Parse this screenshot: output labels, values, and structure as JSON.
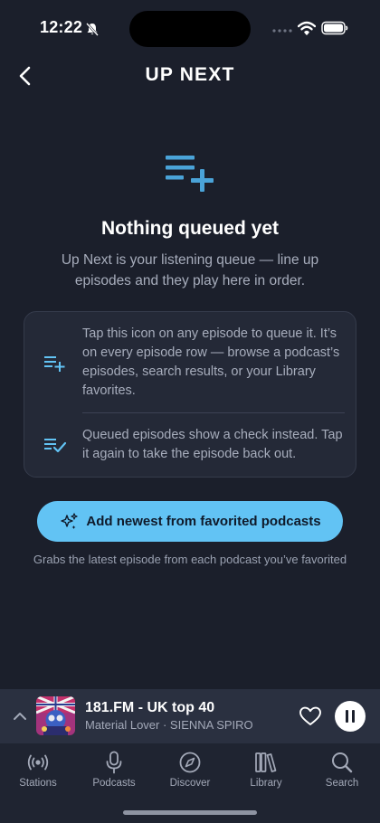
{
  "status_bar": {
    "time": "12:22"
  },
  "header": {
    "title": "UP NEXT"
  },
  "empty_state": {
    "title": "Nothing queued yet",
    "description": "Up Next is your listening queue — line up episodes and they play here in order."
  },
  "info_card": {
    "rows": [
      {
        "icon": "queue-add-icon",
        "text": "Tap this icon on any episode to queue it. It’s on every episode row — browse a podcast’s episodes, search results, or your Library favorites."
      },
      {
        "icon": "queue-check-icon",
        "text": "Queued episodes show a check instead. Tap it again to take the episode back out."
      }
    ]
  },
  "cta": {
    "label": "Add newest from favorited podcasts",
    "caption": "Grabs the latest episode from each podcast you’ve favorited"
  },
  "mini_player": {
    "station": "181.FM - UK top 40",
    "track": "Material Lover",
    "artist": "SIENNA SPIRO",
    "track_line": "Material Lover  · SIENNA SPIRO"
  },
  "tab_bar": {
    "tabs": [
      {
        "label": "Stations",
        "icon": "radio-signal-icon"
      },
      {
        "label": "Podcasts",
        "icon": "microphone-icon"
      },
      {
        "label": "Discover",
        "icon": "compass-icon"
      },
      {
        "label": "Library",
        "icon": "library-icon"
      },
      {
        "label": "Search",
        "icon": "search-icon"
      }
    ]
  },
  "colors": {
    "background": "#1b1f2b",
    "accent": "#62c3f4",
    "icon_blue": "#4aa3d8",
    "card": "#242937",
    "player": "#2a3040"
  }
}
